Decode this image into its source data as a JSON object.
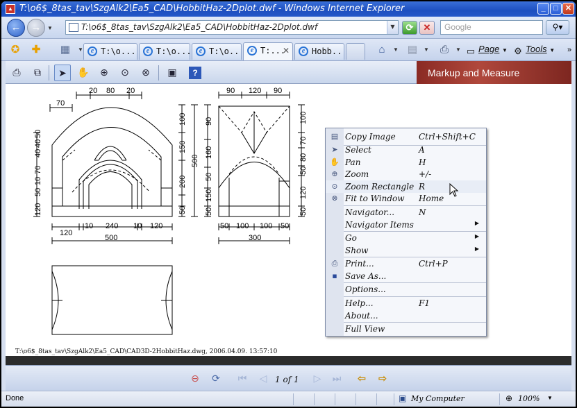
{
  "window": {
    "title": "T:\\o6$_8tas_tav\\SzgAlk2\\Ea5_CAD\\HobbitHaz-2Dplot.dwf - Windows Internet Explorer"
  },
  "address": {
    "url": "T:\\o6$_8tas_tav\\SzgAlk2\\Ea5_CAD\\HobbitHaz-2Dplot.dwf",
    "search_placeholder": "Google"
  },
  "tabs": [
    {
      "label": "T:\\o..."
    },
    {
      "label": "T:\\o..."
    },
    {
      "label": "T:\\o..."
    },
    {
      "label": "T:..."
    },
    {
      "label": "Hobb..."
    }
  ],
  "commands": {
    "page": "Page",
    "tools": "Tools"
  },
  "dwf_toolbar": {
    "banner": "Markup and Measure"
  },
  "drawing": {
    "stamp": "T:\\o6$_8tas_tav\\SzgAlk2\\Ea5_CAD\\CAD3D-2HobbitHaz.dwg, 2006.04.09. 13:57:10",
    "front_top_dims": [
      "20",
      "80",
      "20"
    ],
    "front_left_top_dim": "70",
    "front_left_dims": [
      "50",
      "40",
      "40",
      "70",
      "10",
      "50",
      "120"
    ],
    "front_right_dims": [
      "100",
      "150",
      "200",
      "50"
    ],
    "front_total_height": "500",
    "front_bottom_dims": [
      "120",
      "10",
      "240",
      "10",
      "120"
    ],
    "front_total_width": "500",
    "side_top_dims": [
      "90",
      "120",
      "90"
    ],
    "side_left_dims": [
      "90",
      "160",
      "50",
      "150",
      "50"
    ],
    "side_right_dims": [
      "100",
      "70",
      "80",
      "50",
      "120",
      "50"
    ],
    "side_bottom_dims": [
      "50",
      "100",
      "100",
      "50"
    ],
    "side_total_width": "300"
  },
  "context_menu": {
    "items": [
      {
        "label": "Copy Image",
        "key": "Ctrl+Shift+C",
        "icon": "copy-image-icon"
      },
      {
        "label": "Select",
        "key": "A",
        "icon": "select-arrow-icon"
      },
      {
        "label": "Pan",
        "key": "H",
        "icon": "pan-hand-icon"
      },
      {
        "label": "Zoom",
        "key": "+/-",
        "icon": "zoom-icon"
      },
      {
        "label": "Zoom Rectangle",
        "key": "R",
        "icon": "zoom-rectangle-icon"
      },
      {
        "label": "Fit to Window",
        "key": "Home",
        "icon": "fit-window-icon"
      },
      {
        "label": "Navigator...",
        "key": "N",
        "icon": ""
      },
      {
        "label": "Navigator Items",
        "key": "",
        "icon": "",
        "submenu": true
      },
      {
        "label": "Go",
        "key": "",
        "icon": "",
        "submenu": true
      },
      {
        "label": "Show",
        "key": "",
        "icon": "",
        "submenu": true
      },
      {
        "label": "Print...",
        "key": "Ctrl+P",
        "icon": "print-icon"
      },
      {
        "label": "Save As...",
        "key": "",
        "icon": "save-icon"
      },
      {
        "label": "Options...",
        "key": "",
        "icon": ""
      },
      {
        "label": "Help...",
        "key": "F1",
        "icon": ""
      },
      {
        "label": "About...",
        "key": "",
        "icon": ""
      },
      {
        "label": "Full View",
        "key": "",
        "icon": ""
      }
    ]
  },
  "pager": {
    "current": "1",
    "of_label": "of",
    "total": "1"
  },
  "status": {
    "text": "Done",
    "zone": "My Computer",
    "zoom": "100%"
  },
  "colors": {
    "titlebar": "#1d4fc0",
    "banner": "#8a2a24",
    "menu_gutter": "#dfe4ef"
  }
}
